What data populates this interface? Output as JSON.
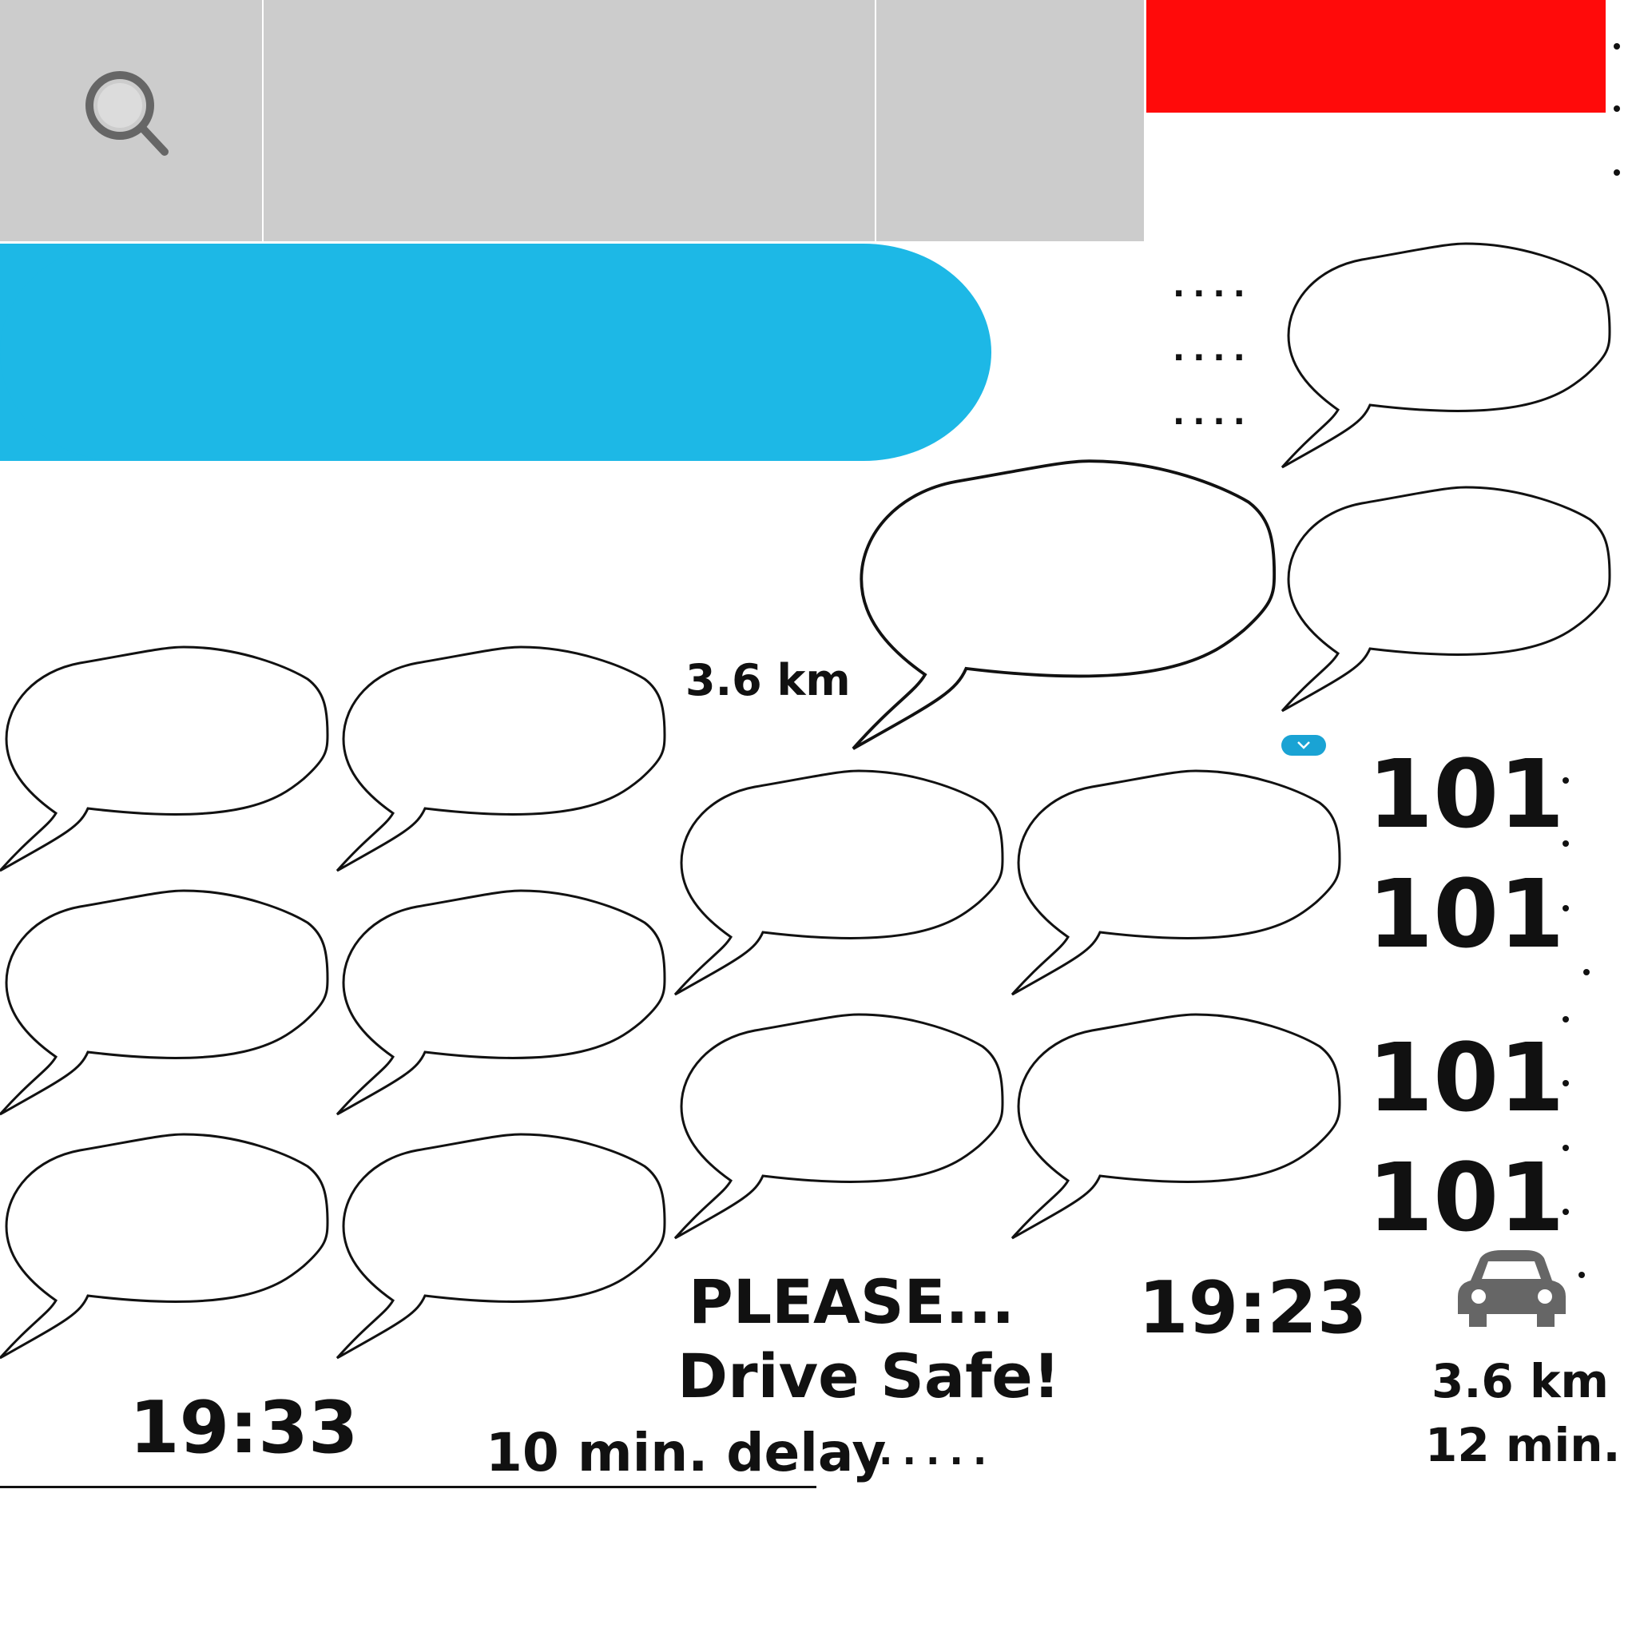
{
  "colors": {
    "toolbar": "#cccccc",
    "alert": "#ff0a0a",
    "accent": "#1db8e6",
    "text": "#111111",
    "icon": "#666666"
  },
  "icons": {
    "search": "search-icon",
    "expand": "chevron-down-icon",
    "car": "car-icon"
  },
  "labels": {
    "distance_top": "3.6 km",
    "route_1": "101",
    "route_2": "101",
    "route_3": "101",
    "route_4": "101",
    "message_line1": "PLEASE...",
    "message_line2": "Drive Safe!",
    "delay": "10 min. delay",
    "delay_dots": ".....",
    "time_arrival": "19:33",
    "time_current": "19:23",
    "distance_bottom": "3.6 km",
    "duration": "12 min.",
    "dots_row": "...."
  }
}
